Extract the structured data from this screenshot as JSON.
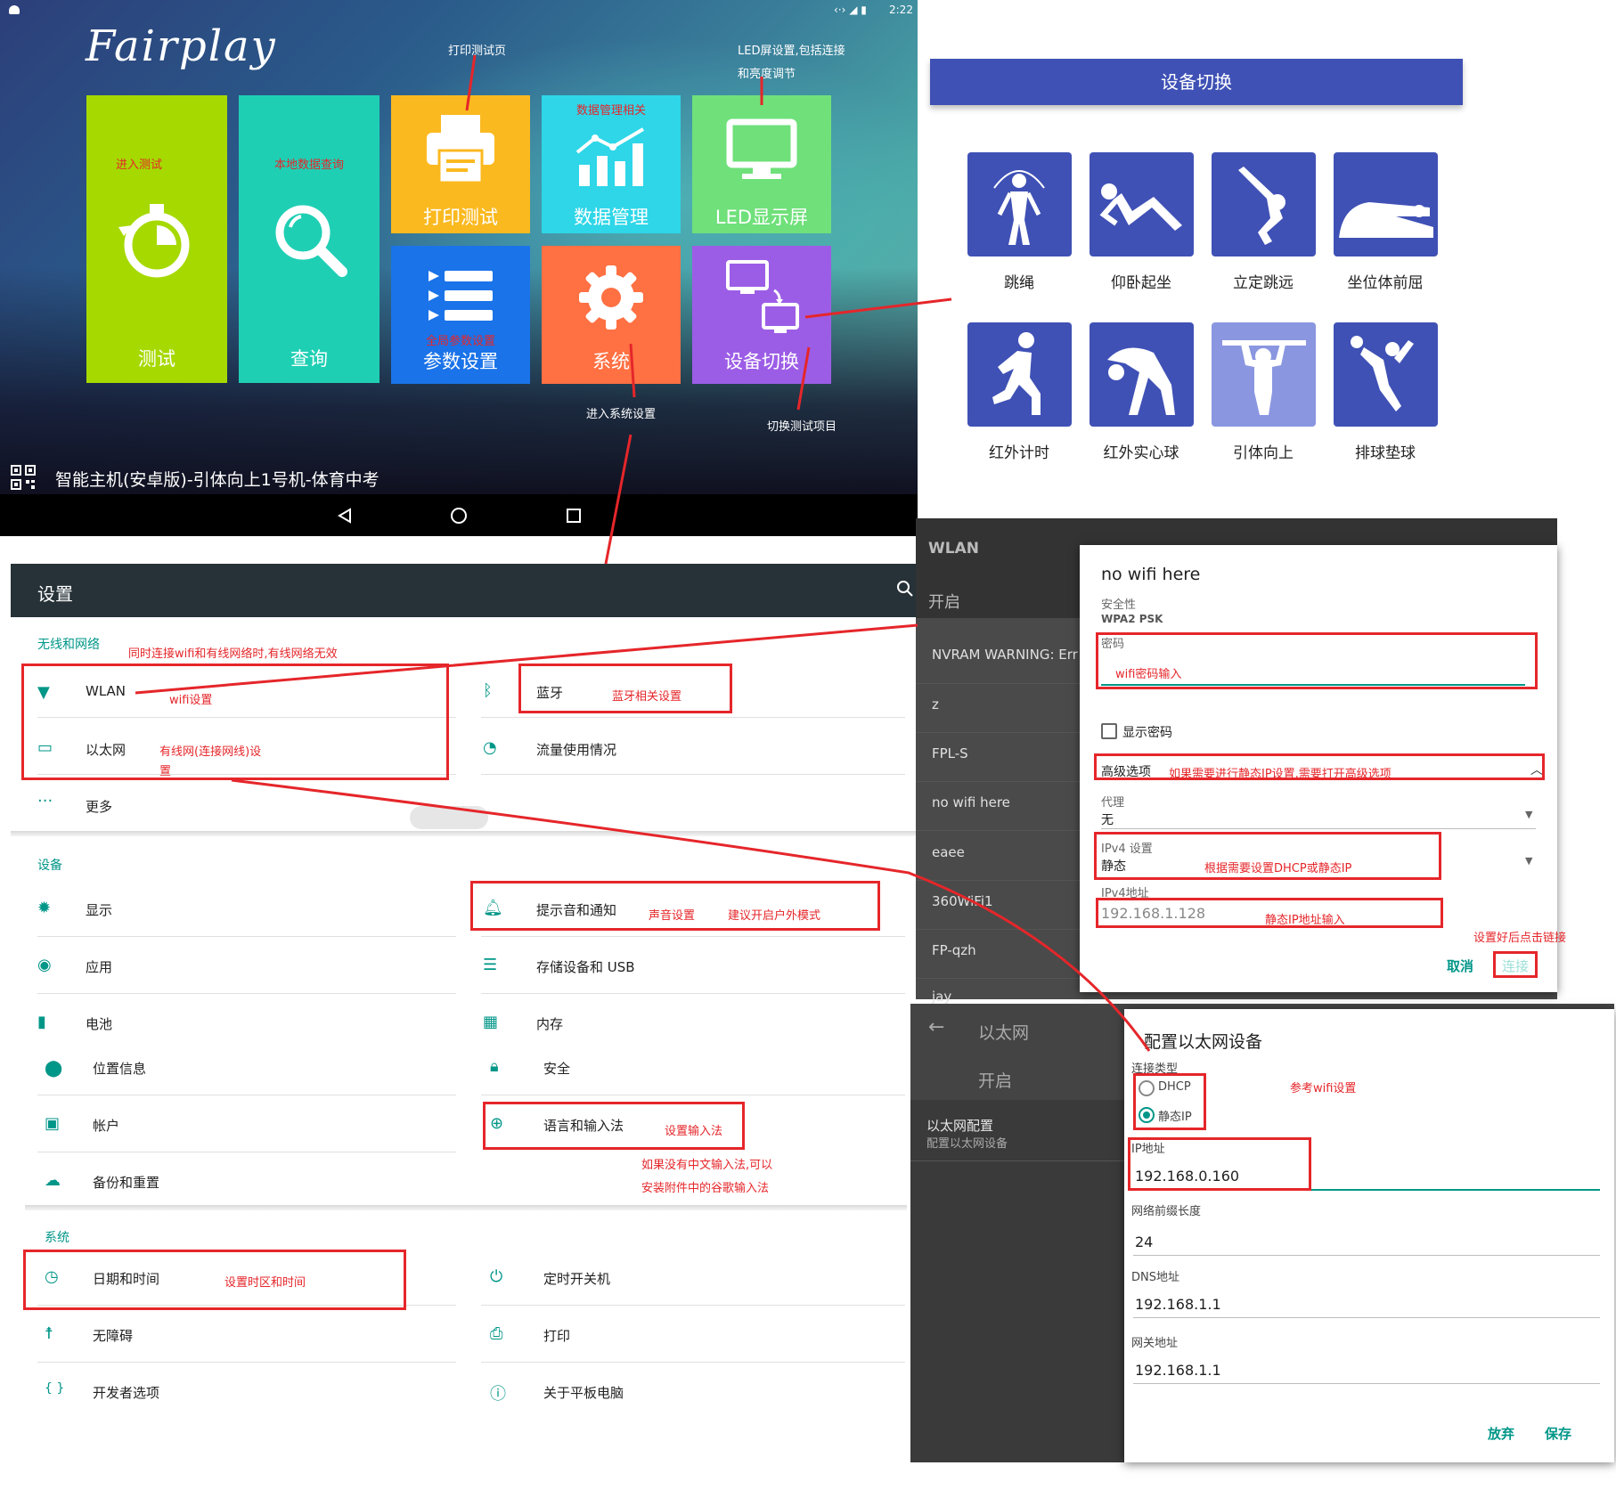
{
  "status_bar": {
    "time": "2:22"
  },
  "launcher": {
    "brand": "Fairplay",
    "tiles": [
      {
        "label": "测试",
        "note": "进入测试",
        "color": "#a6d900"
      },
      {
        "label": "查询",
        "note": "本地数据查询",
        "color": "#1fcfb4"
      },
      {
        "label": "打印测试",
        "color": "#fbb920"
      },
      {
        "label": "数据管理",
        "note": "数据管理相关",
        "color": "#2ed6e8"
      },
      {
        "label": "LED显示屏",
        "color": "#6fe07a"
      },
      {
        "label": "参数设置",
        "note": "全局参数设置",
        "color": "#1a73e8"
      },
      {
        "label": "系统",
        "color": "#ff7043"
      },
      {
        "label": "设备切换",
        "color": "#9c5de6"
      }
    ],
    "footer": "智能主机(安卓版)-引体向上1号机-体育中考",
    "annotations": {
      "print_page": "打印测试页",
      "led_settings_line1": "LED屏设置,包括连接",
      "led_settings_line2": "和亮度调节",
      "system_settings": "进入系统设置",
      "switch_project": "切换测试项目"
    },
    "icons": [
      "stopwatch-icon",
      "search-icon",
      "printer-icon",
      "bar-chart-icon",
      "monitor-icon",
      "list-icon",
      "gear-icon",
      "device-switch-icon"
    ]
  },
  "device_panel": {
    "title": "设备切换",
    "items": [
      "跳绳",
      "仰卧起坐",
      "立定跳远",
      "坐位体前屈",
      "红外计时",
      "红外实心球",
      "引体向上",
      "排球垫球"
    ]
  },
  "settings": {
    "title": "设置",
    "sections": {
      "wireless": "无线和网络",
      "device": "设备",
      "system": "系统"
    },
    "wireless_items": {
      "wlan": "WLAN",
      "bluetooth": "蓝牙",
      "ethernet": "以太网",
      "data_usage": "流量使用情况",
      "more": "更多"
    },
    "device_items": {
      "display": "显示",
      "sound": "提示音和通知",
      "apps": "应用",
      "storage": "存储设备和 USB",
      "battery": "电池",
      "memory": "内存",
      "location": "位置信息",
      "security": "安全",
      "accounts": "帐户",
      "language": "语言和输入法",
      "backup": "备份和重置"
    },
    "system_items": {
      "datetime": "日期和时间",
      "schedule_power": "定时开关机",
      "accessibility": "无障碍",
      "printing": "打印",
      "developer": "开发者选项",
      "about": "关于平板电脑"
    },
    "annotations": {
      "network_note": "同时连接wifi和有线网络时,有线网络无效",
      "wifi_note": "wifi设置",
      "bt_note": "蓝牙相关设置",
      "eth_note_1": "有线网(连接网线)设",
      "eth_note_2": "置",
      "sound_note": "声音设置",
      "outdoor_note": "建议开启户外模式",
      "ime_note": "设置输入法",
      "ime_tip_1": "如果没有中文输入法,可以",
      "ime_tip_2": "安装附件中的谷歌输入法",
      "time_note": "设置时区和时间"
    }
  },
  "wifi_screen": {
    "title": "WLAN",
    "toggle": "开启",
    "networks": [
      "NVRAM WARNING: Err",
      "z",
      "FPL-S",
      "no wifi here",
      "eaee",
      "360WiFi1",
      "FP-qzh",
      "jay"
    ],
    "dialog": {
      "ssid": "no wifi here",
      "security_label": "安全性",
      "security_value": "WPA2 PSK",
      "password_label": "密码",
      "password_note": "wifi密码输入",
      "show_password": "显示密码",
      "advanced": "高级选项",
      "advanced_note": "如果需要进行静态IP设置,需要打开高级选项",
      "proxy_label": "代理",
      "proxy_value": "无",
      "ipv4_label": "IPv4 设置",
      "ipv4_value": "静态",
      "ipv4_note": "根据需要设置DHCP或静态IP",
      "ip_label": "IPv4地址",
      "ip_value": "192.168.1.128",
      "ip_note": "静态IP地址输入",
      "connect_note": "设置好后点击链接",
      "cancel": "取消",
      "connect": "连接"
    }
  },
  "ethernet_screen": {
    "title": "以太网",
    "toggle": "开启",
    "config_title": "以太网配置",
    "config_sub": "配置以太网设备",
    "dialog": {
      "title": "配置以太网设备",
      "conn_type": "连接类型",
      "dhcp": "DHCP",
      "static": "静态IP",
      "ref_note": "参考wifi设置",
      "ip_label": "IP地址",
      "ip_value": "192.168.0.160",
      "prefix_label": "网络前缀长度",
      "prefix_value": "24",
      "dns_label": "DNS地址",
      "dns_value": "192.168.1.1",
      "gw_label": "网关地址",
      "gw_value": "192.168.1.1",
      "discard": "放弃",
      "save": "保存"
    }
  }
}
